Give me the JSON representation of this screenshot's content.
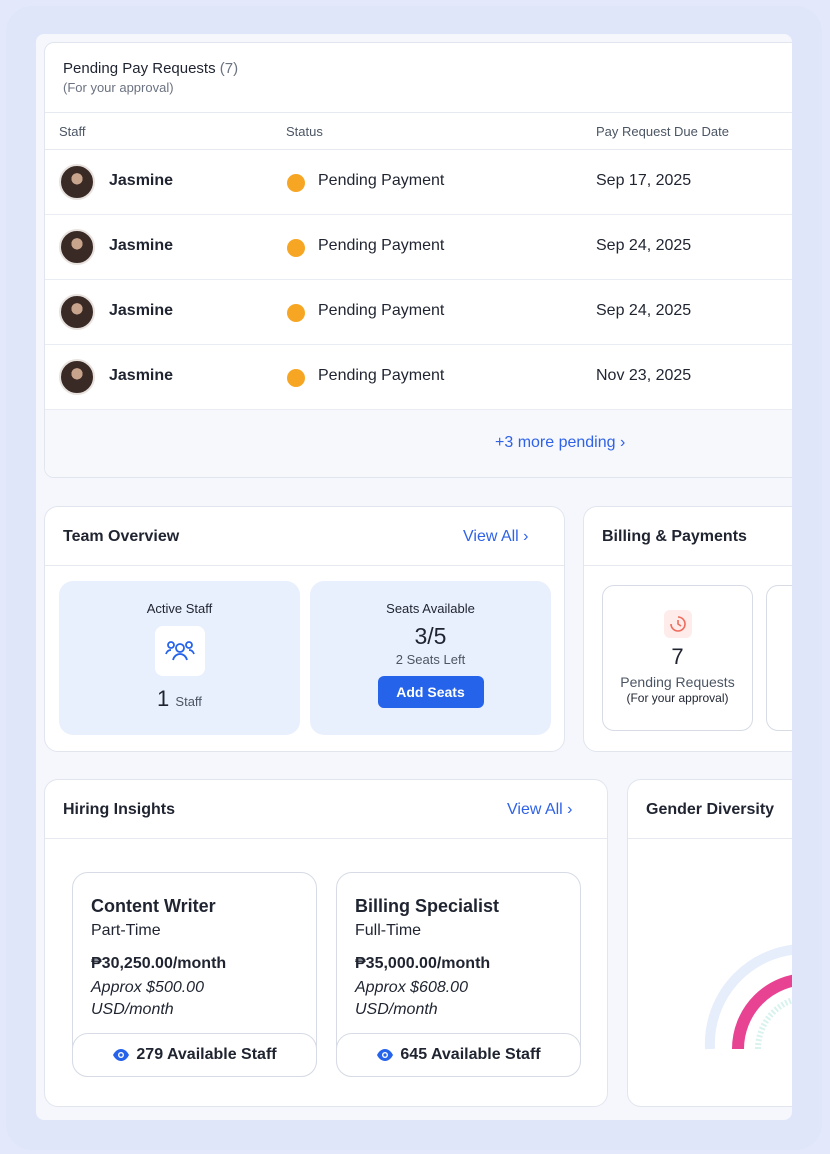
{
  "pending": {
    "title": "Pending Pay Requests",
    "count": "(7)",
    "subtitle": "(For your approval)",
    "columns": [
      "Staff",
      "Status",
      "Pay Request Due Date"
    ],
    "rows": [
      {
        "name": "Jasmine",
        "status": "Pending Payment",
        "date": "Sep 17, 2025"
      },
      {
        "name": "Jasmine",
        "status": "Pending Payment",
        "date": "Sep 24, 2025"
      },
      {
        "name": "Jasmine",
        "status": "Pending Payment",
        "date": "Sep 24, 2025"
      },
      {
        "name": "Jasmine",
        "status": "Pending Payment",
        "date": "Nov 23, 2025"
      }
    ],
    "more_link": "+3 more pending ›",
    "status_color": "#f6a623"
  },
  "team": {
    "title": "Team Overview",
    "view_all": "View All ›",
    "active_label": "Active Staff",
    "active_count": "1",
    "active_unit": "Staff",
    "seats_label": "Seats Available",
    "seats_value": "3/5",
    "seats_left": "2 Seats Left",
    "add_seats": "Add Seats"
  },
  "billing": {
    "title": "Billing & Payments",
    "count": "7",
    "label": "Pending Requests",
    "sub": "(For your approval)"
  },
  "hiring": {
    "title": "Hiring Insights",
    "view_all": "View All ›",
    "jobs": [
      {
        "title": "Content Writer",
        "type": "Part-Time",
        "pay": "₱30,250.00/month",
        "approx": "Approx $500.00 USD/month",
        "available": "279 Available Staff"
      },
      {
        "title": "Billing Specialist",
        "type": "Full-Time",
        "pay": "₱35,000.00/month",
        "approx": "Approx $608.00 USD/month",
        "available": "645 Available Staff"
      }
    ]
  },
  "gender": {
    "title": "Gender Diversity"
  },
  "colors": {
    "accent": "#2563eb",
    "link": "#2f62e6",
    "tile_bg": "#e9f0fd"
  }
}
